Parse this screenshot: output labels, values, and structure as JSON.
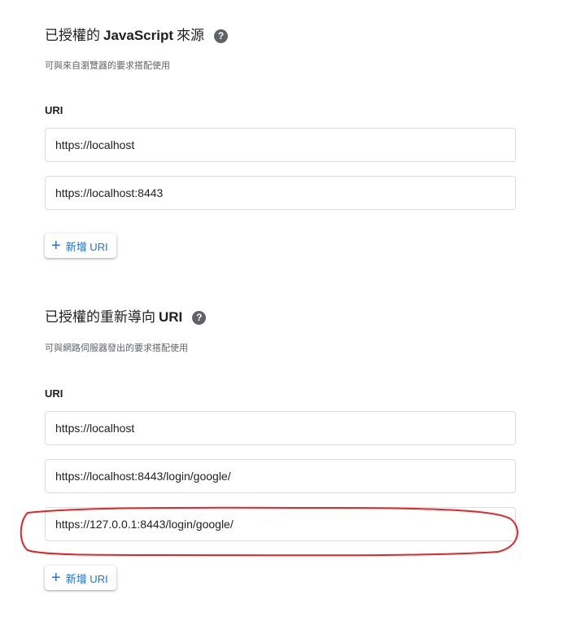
{
  "js_origins": {
    "title_prefix": "已授權的",
    "title_bold": "JavaScript",
    "title_suffix": "來源",
    "description": "可與來自瀏覽器的要求搭配使用",
    "uri_label": "URI",
    "uris": [
      "https://localhost",
      "https://localhost:8443"
    ],
    "add_button_label": "新增 URI"
  },
  "redirect_uris": {
    "title_prefix": "已授權的重新導向",
    "title_bold": "URI",
    "description": "可與網路伺服器發出的要求搭配使用",
    "uri_label": "URI",
    "uris": [
      "https://localhost",
      "https://localhost:8443/login/google/",
      "https://127.0.0.1:8443/login/google/"
    ],
    "add_button_label": "新增 URI"
  },
  "icons": {
    "help": "help-circle-icon",
    "add": "plus-icon"
  },
  "colors": {
    "accent": "#1a73e8",
    "annotation": "#e3242b"
  }
}
